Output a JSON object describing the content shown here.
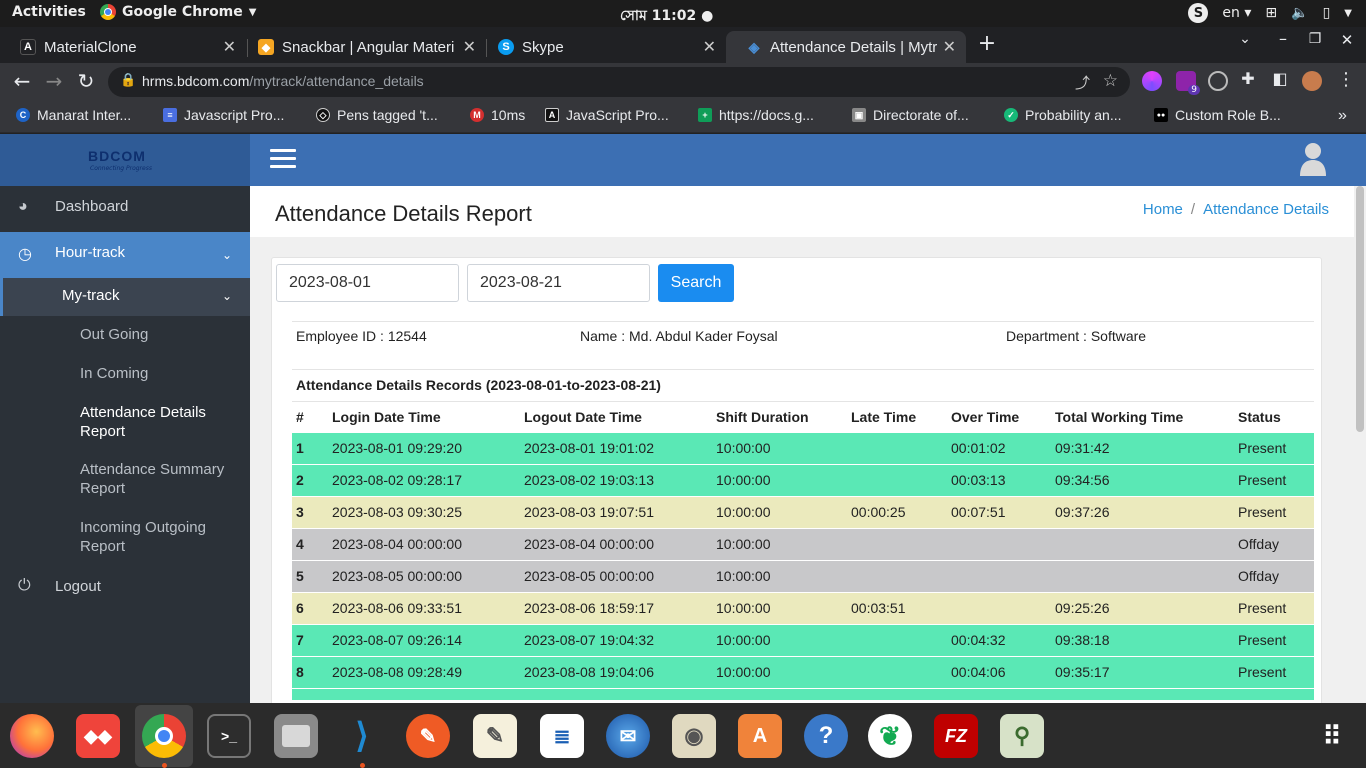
{
  "system_bar": {
    "activities": "Activities",
    "app_name": "Google Chrome",
    "clock": "সোম 11:02 ●",
    "skype_initial": "S",
    "language": "en"
  },
  "tabs": [
    {
      "title": "MaterialClone",
      "favicon": "A"
    },
    {
      "title": "Snackbar | Angular Materi",
      "favicon": "◆"
    },
    {
      "title": "Skype",
      "favicon": "S"
    },
    {
      "title": "Attendance Details | Mytr",
      "favicon": "◈",
      "active": true
    }
  ],
  "omnibox": {
    "host": "hrms.bdcom.com",
    "path": "/mytrack/attendance_details"
  },
  "extension_badge": "9",
  "bookmarks": [
    {
      "label": "Manarat Inter...",
      "icon": "C"
    },
    {
      "label": "Javascript Pro...",
      "icon": "≡"
    },
    {
      "label": "Pens tagged 't...",
      "icon": "◇"
    },
    {
      "label": "10ms",
      "icon": "M"
    },
    {
      "label": "JavaScript Pro...",
      "icon": "A"
    },
    {
      "label": "https://docs.g...",
      "icon": "+"
    },
    {
      "label": "Directorate of...",
      "icon": "▣"
    },
    {
      "label": "Probability an...",
      "icon": "✓"
    },
    {
      "label": "Custom Role B...",
      "icon": "●●"
    }
  ],
  "brand": {
    "name": "BDCOM",
    "tagline": "Connecting Progress"
  },
  "sidebar": {
    "dashboard": "Dashboard",
    "hour_track": "Hour-track",
    "my_track": "My-track",
    "items": [
      "Out Going",
      "In Coming",
      "Attendance Details Report",
      "Attendance Summary Report",
      "Incoming Outgoing Report"
    ],
    "logout": "Logout"
  },
  "page": {
    "title": "Attendance Details Report",
    "breadcrumb": {
      "home": "Home",
      "sep": "/",
      "current": "Attendance Details"
    }
  },
  "filters": {
    "from_date": "2023-08-01",
    "to_date": "2023-08-21",
    "search_label": "Search"
  },
  "employee": {
    "id_text": "Employee ID : 12544",
    "name_text": "Name : Md. Abdul Kader Foysal",
    "dept_text": "Department : Software"
  },
  "records_title": "Attendance Details Records (2023-08-01-to-2023-08-21)",
  "table": {
    "headers": [
      "#",
      "Login Date Time",
      "Logout Date Time",
      "Shift Duration",
      "Late Time",
      "Over Time",
      "Total Working Time",
      "Status"
    ],
    "rows": [
      {
        "n": "1",
        "login": "2023-08-01 09:29:20",
        "logout": "2023-08-01 19:01:02",
        "shift": "10:00:00",
        "late": "",
        "over": "00:01:02",
        "total": "09:31:42",
        "status": "Present",
        "kind": "present"
      },
      {
        "n": "2",
        "login": "2023-08-02 09:28:17",
        "logout": "2023-08-02 19:03:13",
        "shift": "10:00:00",
        "late": "",
        "over": "00:03:13",
        "total": "09:34:56",
        "status": "Present",
        "kind": "present"
      },
      {
        "n": "3",
        "login": "2023-08-03 09:30:25",
        "logout": "2023-08-03 19:07:51",
        "shift": "10:00:00",
        "late": "00:00:25",
        "over": "00:07:51",
        "total": "09:37:26",
        "status": "Present",
        "kind": "late"
      },
      {
        "n": "4",
        "login": "2023-08-04 00:00:00",
        "logout": "2023-08-04 00:00:00",
        "shift": "10:00:00",
        "late": "",
        "over": "",
        "total": "",
        "status": "Offday",
        "kind": "offday"
      },
      {
        "n": "5",
        "login": "2023-08-05 00:00:00",
        "logout": "2023-08-05 00:00:00",
        "shift": "10:00:00",
        "late": "",
        "over": "",
        "total": "",
        "status": "Offday",
        "kind": "offday"
      },
      {
        "n": "6",
        "login": "2023-08-06 09:33:51",
        "logout": "2023-08-06 18:59:17",
        "shift": "10:00:00",
        "late": "00:03:51",
        "over": "",
        "total": "09:25:26",
        "status": "Present",
        "kind": "late"
      },
      {
        "n": "7",
        "login": "2023-08-07 09:26:14",
        "logout": "2023-08-07 19:04:32",
        "shift": "10:00:00",
        "late": "",
        "over": "00:04:32",
        "total": "09:38:18",
        "status": "Present",
        "kind": "present"
      },
      {
        "n": "8",
        "login": "2023-08-08 09:28:49",
        "logout": "2023-08-08 19:04:06",
        "shift": "10:00:00",
        "late": "",
        "over": "00:04:06",
        "total": "09:35:17",
        "status": "Present",
        "kind": "present"
      }
    ]
  },
  "colors": {
    "header_blue": "#3c6fb3",
    "sidebar": "#2b3138",
    "present": "#5ae8b5",
    "late": "#ebeabd",
    "offday": "#c8c8ca",
    "primary": "#1a8cf0"
  },
  "dock_apps": [
    "firefox-icon",
    "anydesk-icon",
    "chrome-icon",
    "terminal-icon",
    "files-icon",
    "vscode-icon",
    "postman-icon",
    "text-editor-icon",
    "writer-icon",
    "thunderbird-icon",
    "rhythmbox-icon",
    "software-center-icon",
    "help-icon",
    "mongodb-compass-icon",
    "filezilla-icon",
    "image-viewer-icon",
    "show-apps-icon"
  ],
  "dock_labels": {
    "anydesk": "◆◆",
    "filezilla": "FZ",
    "help": "?"
  }
}
